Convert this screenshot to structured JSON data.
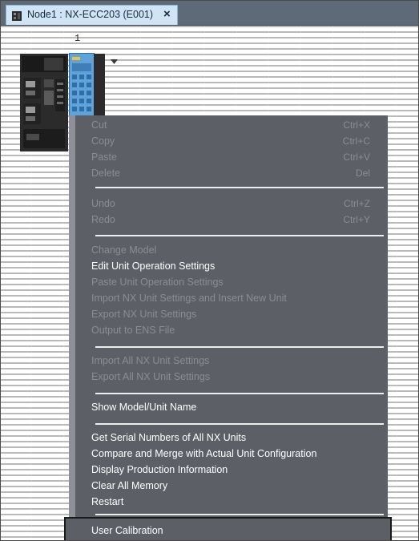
{
  "tab": {
    "title": "Node1 : NX-ECC203 (E001)",
    "close_glyph": "×",
    "icon": "device-icon"
  },
  "canvas": {
    "column_number": "1"
  },
  "menu": {
    "items": [
      {
        "label": "Cut",
        "shortcut": "Ctrl+X",
        "enabled": false
      },
      {
        "label": "Copy",
        "shortcut": "Ctrl+C",
        "enabled": false
      },
      {
        "label": "Paste",
        "shortcut": "Ctrl+V",
        "enabled": false
      },
      {
        "label": "Delete",
        "shortcut": "Del",
        "enabled": false
      },
      {
        "label": "Undo",
        "shortcut": "Ctrl+Z",
        "enabled": false
      },
      {
        "label": "Redo",
        "shortcut": "Ctrl+Y",
        "enabled": false
      },
      {
        "label": "Change Model",
        "enabled": false
      },
      {
        "label": "Edit Unit Operation Settings",
        "enabled": true
      },
      {
        "label": "Paste Unit Operation Settings",
        "enabled": false
      },
      {
        "label": "Import NX Unit Settings and Insert New Unit",
        "enabled": false
      },
      {
        "label": "Export NX Unit Settings",
        "enabled": false
      },
      {
        "label": "Output to ENS File",
        "enabled": false
      },
      {
        "label": "Import All NX Unit Settings",
        "enabled": false
      },
      {
        "label": "Export All NX Unit Settings",
        "enabled": false
      },
      {
        "label": "Show Model/Unit Name",
        "enabled": true
      },
      {
        "label": "Get Serial Numbers of All NX Units",
        "enabled": true
      },
      {
        "label": "Compare and Merge with Actual Unit Configuration",
        "enabled": true
      },
      {
        "label": "Display Production Information",
        "enabled": true
      },
      {
        "label": "Clear All Memory",
        "enabled": true
      },
      {
        "label": "Restart",
        "enabled": true
      },
      {
        "label": "User Calibration",
        "enabled": true
      }
    ]
  }
}
